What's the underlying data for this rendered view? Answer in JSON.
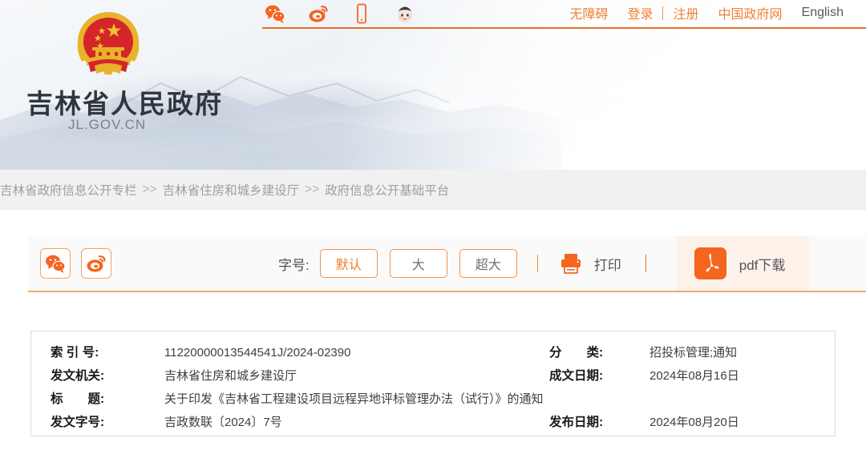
{
  "header": {
    "emblem_icon": "china-national-emblem",
    "site_title": "吉林省人民政府",
    "site_domain": "JL.GOV.CN",
    "social_icons": [
      {
        "name": "wechat-icon",
        "label": "微信"
      },
      {
        "name": "weibo-icon",
        "label": "微博"
      },
      {
        "name": "mobile-icon",
        "label": "手机版"
      },
      {
        "name": "mascot-avatar-icon",
        "label": "吉祥物"
      }
    ],
    "links": [
      {
        "label": "无障碍",
        "style": "orange"
      },
      {
        "label": "登录",
        "style": "orange"
      },
      {
        "label": "注册",
        "style": "orange"
      },
      {
        "label": "中国政府网",
        "style": "orange"
      },
      {
        "label": "English",
        "style": "dark"
      }
    ]
  },
  "breadcrumb": {
    "items": [
      "吉林省政府信息公开专栏",
      "吉林省住房和城乡建设厅",
      "政府信息公开基础平台"
    ],
    "separator": ">>"
  },
  "toolbar": {
    "share": [
      {
        "name": "wechat-share-icon",
        "label": "分享到微信"
      },
      {
        "name": "weibo-share-icon",
        "label": "分享到微博"
      }
    ],
    "fontsize_label": "字号:",
    "fontsize_buttons": [
      {
        "label": "默认",
        "active": true
      },
      {
        "label": "大",
        "active": false
      },
      {
        "label": "超大",
        "active": false
      }
    ],
    "print_label": "打印",
    "print_icon": "printer-icon",
    "pdf_label": "pdf下载",
    "pdf_icon": "pdf-icon"
  },
  "info": {
    "rows": [
      {
        "left_label": "索 引 号:",
        "left_value": "11220000013544541J/2024-02390",
        "right_label": "分　　类:",
        "right_value": "招投标管理;通知"
      },
      {
        "left_label": "发文机关:",
        "left_value": "吉林省住房和城乡建设厅",
        "right_label": "成文日期:",
        "right_value": "2024年08月16日"
      },
      {
        "left_label": "标　　题:",
        "left_value": "关于印发《吉林省工程建设项目远程异地评标管理办法（试行）》的通知",
        "right_label": "",
        "right_value": ""
      },
      {
        "left_label": "发文字号:",
        "left_value": "吉政数联〔2024〕7号",
        "right_label": "发布日期:",
        "right_value": "2024年08月20日"
      }
    ]
  },
  "colors": {
    "accent_orange": "#e2702a",
    "link_orange": "#ef8137",
    "pdf_red": "#f4651f",
    "band_gray": "#f1f1f1"
  }
}
